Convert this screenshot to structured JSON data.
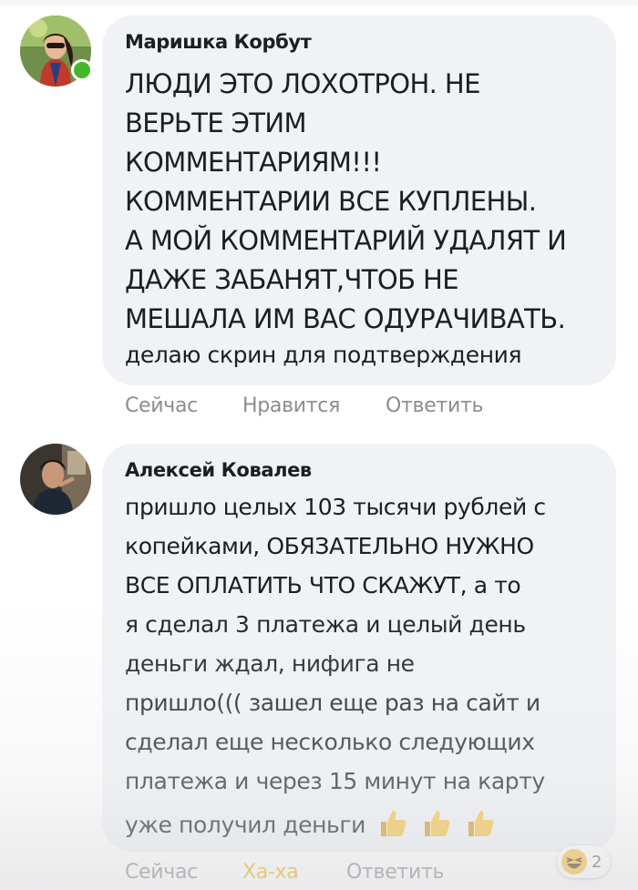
{
  "comments": [
    {
      "author": "Маришка Корбут",
      "online": true,
      "lines": [
        "ЛЮДИ ЭТО ЛОХОТРОН. НЕ",
        "ВЕРЬТЕ ЭТИМ",
        "КОММЕНТАРИЯМ!!!",
        "КОММЕНТАРИИ ВСЕ КУПЛЕНЫ.",
        "А МОЙ КОММЕНТАРИЙ УДАЛЯТ И",
        "ДАЖЕ ЗАБАНЯТ,ЧТОБ НЕ",
        "МЕШАЛА ИМ ВАС ОДУРАЧИВАТЬ.",
        "делаю скрин для подтверждения"
      ],
      "actions": {
        "time": "Сейчас",
        "like": "Нравится",
        "reply": "Ответить"
      }
    },
    {
      "author": "Алексей Ковалев",
      "online": false,
      "lines": [
        "пришло целых 103 тысячи рублей с",
        "копейками, ОБЯЗАТЕЛЬНО НУЖНО",
        "ВСЕ ОПЛАТИТЬ ЧТО СКАЖУТ, а то",
        "я сделал 3 платежа и целый день",
        "деньги ждал, нифига не",
        "пришло((( зашел еще раз на сайт и",
        "сделал еще несколько следующих",
        "платежа и через 15 минут на карту",
        "уже получил деньги"
      ],
      "emoji": [
        "thumbs-up-icon",
        "thumbs-up-icon",
        "thumbs-up-icon"
      ],
      "actions": {
        "time": "Сейчас",
        "reaction": "Ха-ха",
        "reply": "Ответить"
      },
      "reaction_count": "2",
      "reaction_icon": "laughing-emoji-icon"
    }
  ],
  "colors": {
    "bubble": "#f0f2f5",
    "online": "#42b72a",
    "haha": "#f2b01e",
    "meta": "#8a8d91"
  }
}
